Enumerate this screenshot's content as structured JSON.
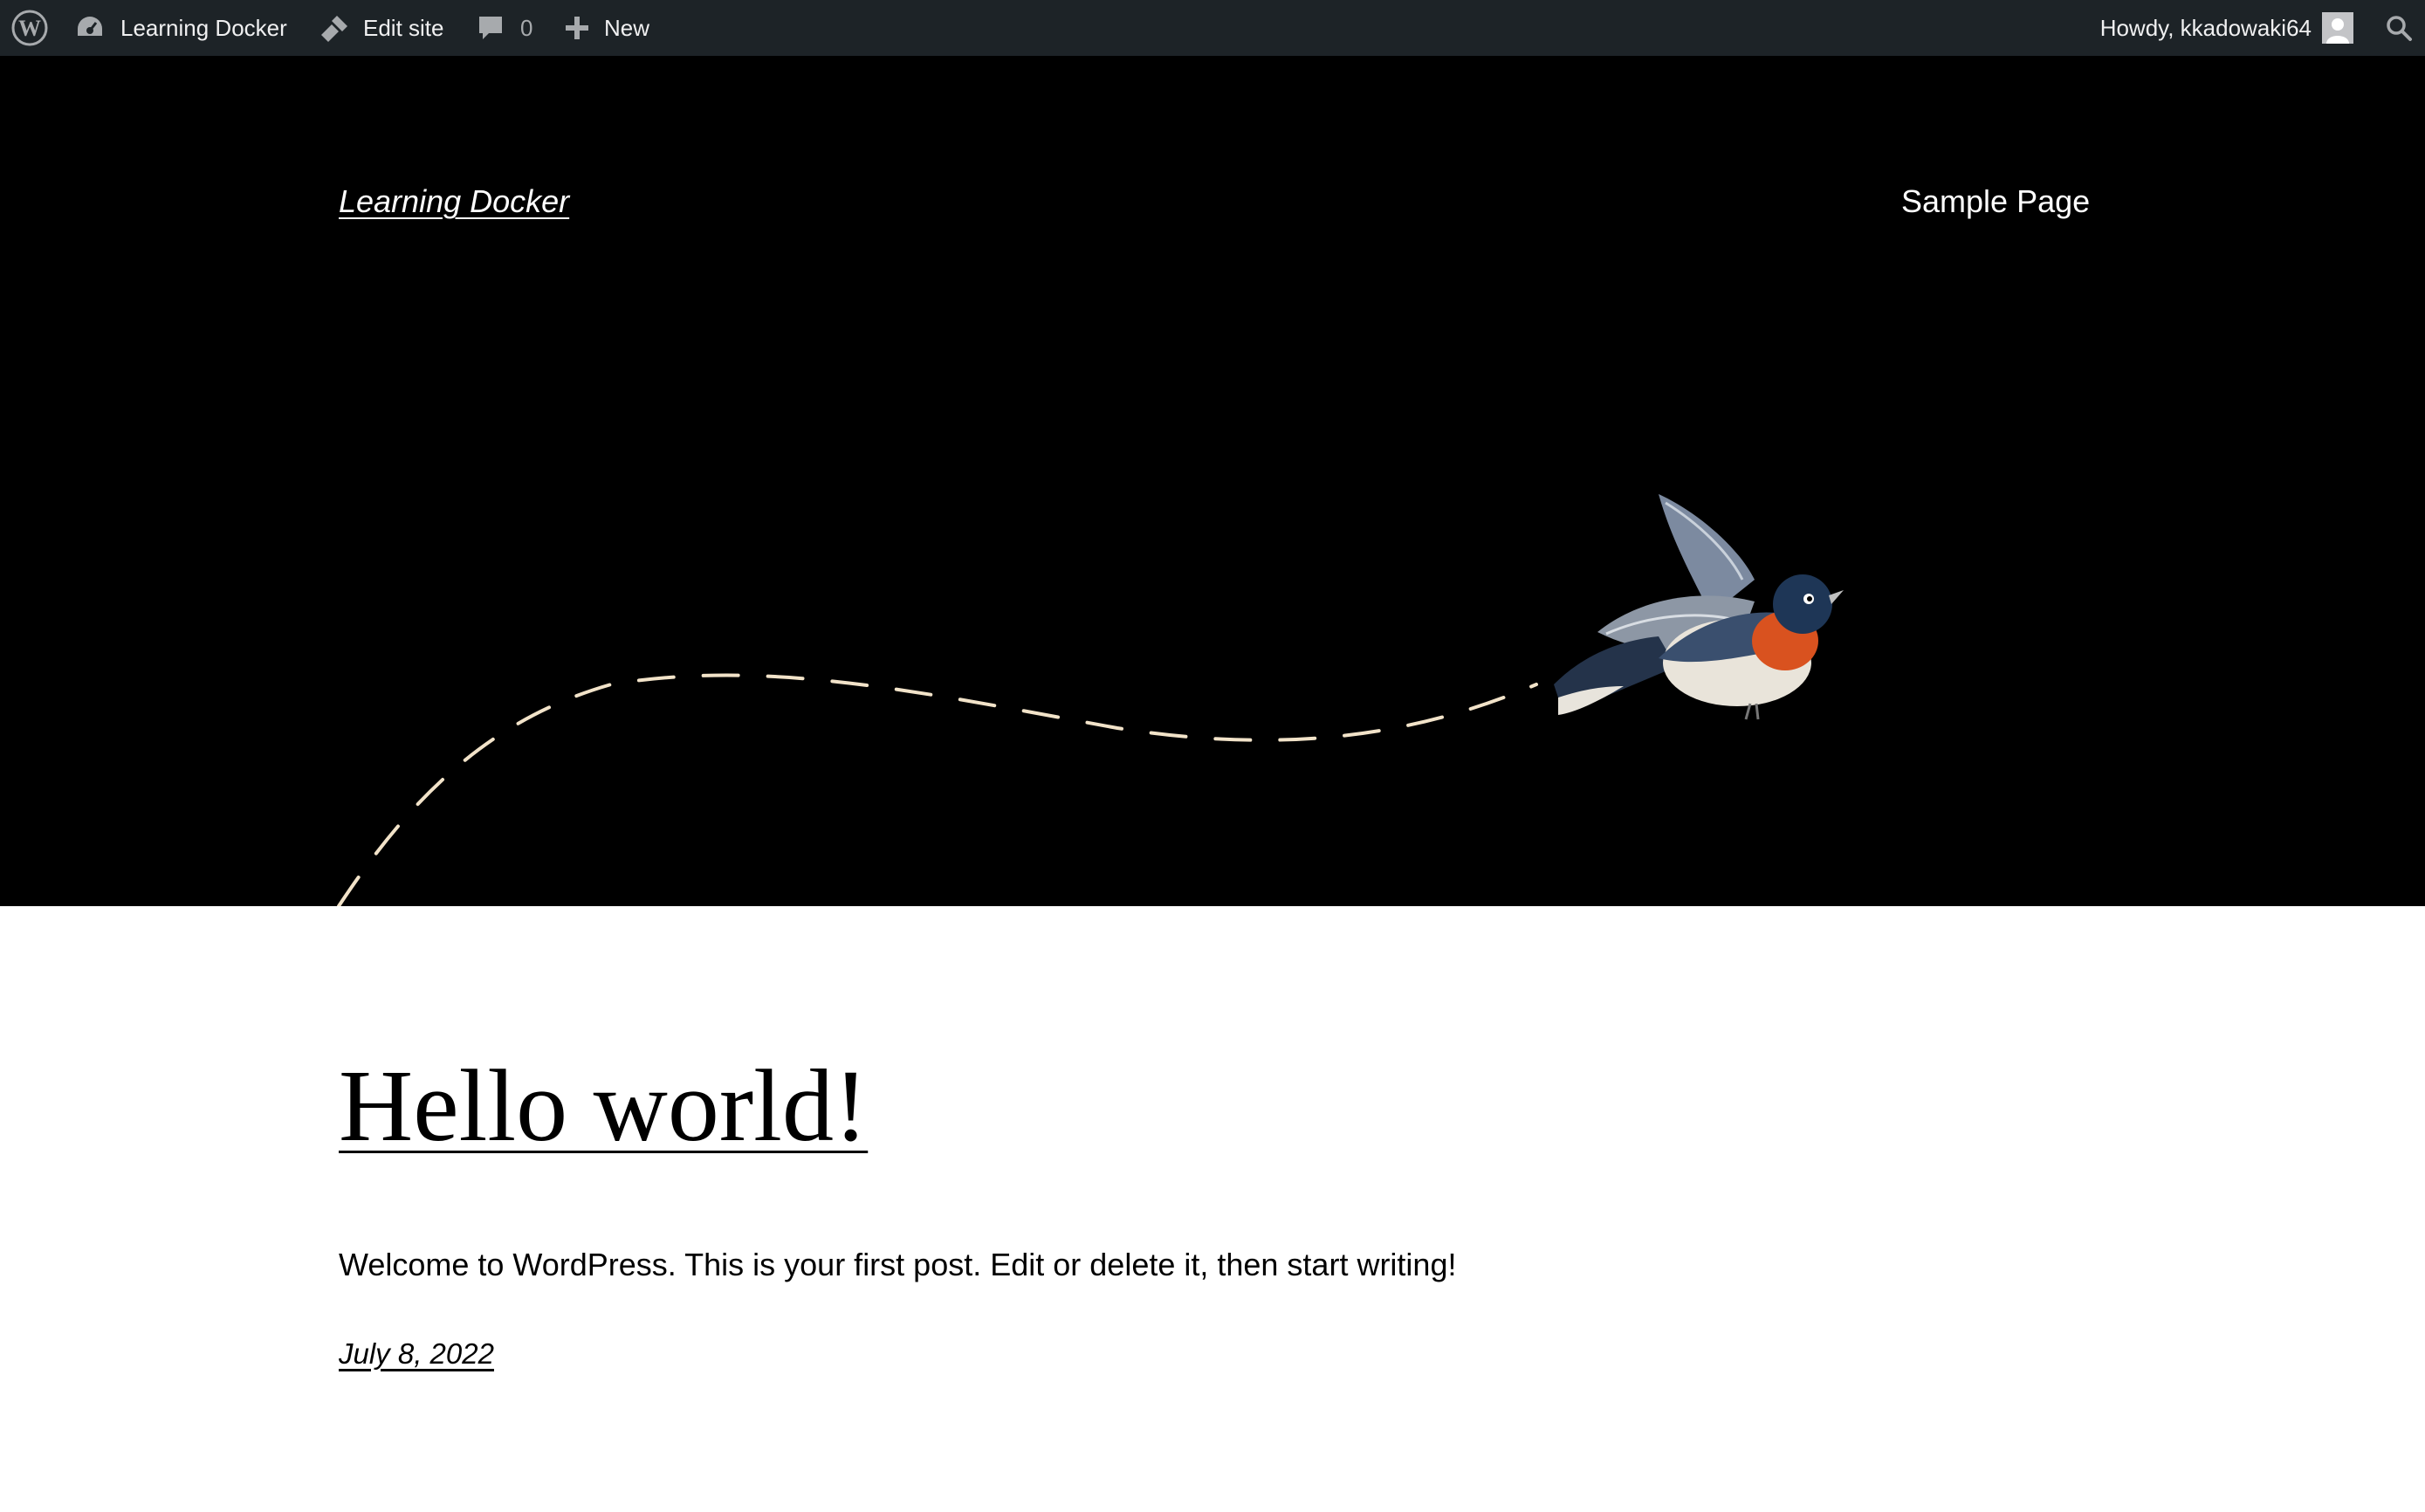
{
  "admin_bar": {
    "wp_logo_icon": "wordpress-logo-icon",
    "site_name": "Learning Docker",
    "site_icon": "dashboard-icon",
    "edit_site": "Edit site",
    "edit_icon": "brush-icon",
    "comments_count": "0",
    "comments_icon": "comment-icon",
    "new_label": "New",
    "new_icon": "plus-icon",
    "howdy": "Howdy, kkadowaki64",
    "avatar_icon": "avatar-icon",
    "search_icon": "search-icon",
    "background_color": "#1d2327"
  },
  "header": {
    "site_title": "Learning Docker",
    "nav_items": [
      "Sample Page"
    ],
    "background_color": "#000000",
    "illustration": "bird-with-dashed-flight-path"
  },
  "post": {
    "title": "Hello world!",
    "excerpt": "Welcome to WordPress. This is your first post. Edit or delete it, then start writing!",
    "date": "July 8, 2022"
  }
}
